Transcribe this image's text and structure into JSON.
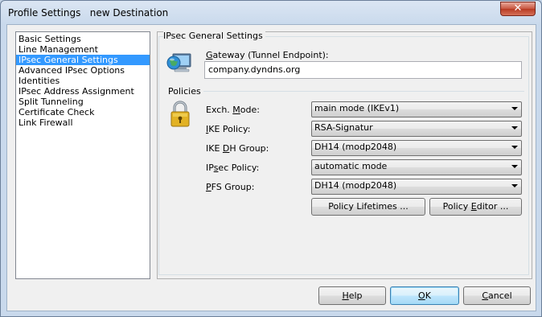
{
  "window": {
    "title": "Profile Settings   new Destination",
    "close_symbol": "✕"
  },
  "nav": {
    "items": [
      {
        "label": "Basic Settings",
        "selected": false
      },
      {
        "label": "Line Management",
        "selected": false
      },
      {
        "label": "IPsec General Settings",
        "selected": true
      },
      {
        "label": "Advanced IPsec Options",
        "selected": false
      },
      {
        "label": "Identities",
        "selected": false
      },
      {
        "label": "IPsec Address Assignment",
        "selected": false
      },
      {
        "label": "Split Tunneling",
        "selected": false
      },
      {
        "label": "Certificate Check",
        "selected": false
      },
      {
        "label": "Link Firewall",
        "selected": false
      }
    ]
  },
  "section": {
    "title": "IPsec General Settings",
    "gateway_label_accel": "G",
    "gateway_label_rest": "ateway (Tunnel Endpoint):",
    "gateway_value": "company.dyndns.org",
    "policies_title": "Policies"
  },
  "policies": {
    "exch_mode": {
      "label_pre": "Exch. ",
      "accel": "M",
      "label_post": "ode:",
      "value": "main mode (IKEv1)"
    },
    "ike_policy": {
      "label_pre": "",
      "accel": "I",
      "label_post": "KE Policy:",
      "value": "RSA-Signatur"
    },
    "ike_dh_group": {
      "label_pre": "IKE ",
      "accel": "D",
      "label_post": "H Group:",
      "value": "DH14 (modp2048)"
    },
    "ipsec_policy": {
      "label_pre": "IP",
      "accel": "s",
      "label_post": "ec Policy:",
      "value": "automatic mode"
    },
    "pfs_group": {
      "label_pre": "",
      "accel": "P",
      "label_post": "FS Group:",
      "value": "DH14 (modp2048)"
    }
  },
  "buttons": {
    "policy_lifetimes": "Policy Lifetimes ...",
    "policy_editor_pre": "Policy ",
    "policy_editor_accel": "E",
    "policy_editor_post": "ditor ...",
    "help_accel": "H",
    "help_rest": "elp",
    "ok_accel": "O",
    "ok_rest": "K",
    "cancel_accel": "C",
    "cancel_rest": "ancel"
  },
  "icons": {
    "gateway": "computer-globe-icon",
    "policies": "padlock-icon"
  }
}
